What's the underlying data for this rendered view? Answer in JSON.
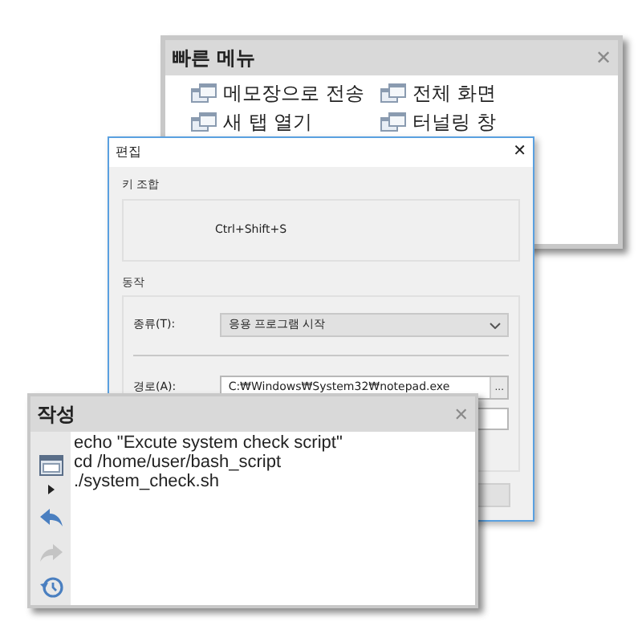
{
  "quick_menu": {
    "title": "빠른 메뉴",
    "close": "✕",
    "items": [
      {
        "label": "메모장으로 전송"
      },
      {
        "label": "전체 화면"
      },
      {
        "label": "새 탭 열기"
      },
      {
        "label": "터널링 창"
      }
    ]
  },
  "edit_dialog": {
    "title": "편집",
    "close": "✕",
    "key_group": {
      "title": "키 조합",
      "shortcut": "Ctrl+Shift+S"
    },
    "action_group": {
      "title": "동작",
      "type_label": "종류(T):",
      "type_value": "응용 프로그램 시작",
      "path_label": "경로(A):",
      "path_value": "C:₩Windows₩System32₩notepad.exe",
      "browse": "..."
    }
  },
  "compose": {
    "title": "작성",
    "close": "✕",
    "lines": [
      "echo \"Excute system check script\"",
      "cd /home/user/bash_script",
      "./system_check.sh"
    ],
    "tools": [
      {
        "kind": "window",
        "disabled": false
      },
      {
        "kind": "undo",
        "disabled": false
      },
      {
        "kind": "redo",
        "disabled": true
      },
      {
        "kind": "history",
        "disabled": false
      }
    ]
  }
}
